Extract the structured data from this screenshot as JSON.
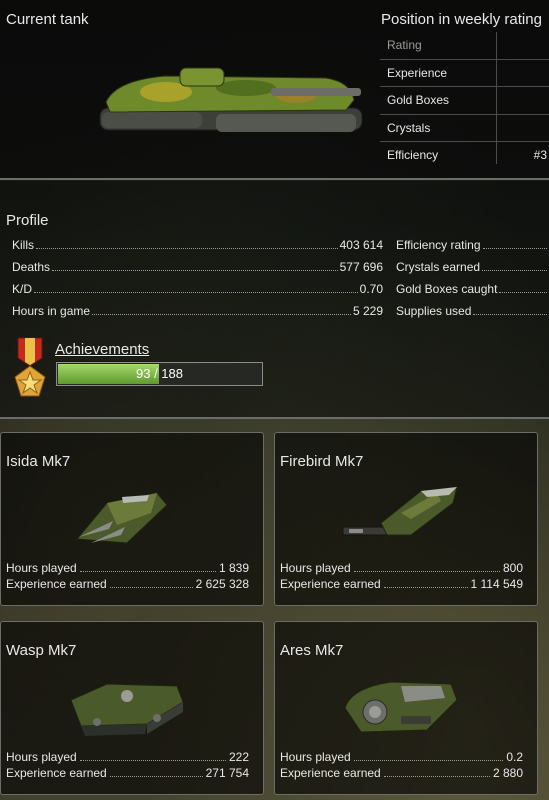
{
  "current_tank": {
    "label": "Current tank"
  },
  "weekly": {
    "title": "Position in weekly rating",
    "rows": [
      {
        "label": "Rating",
        "value": ""
      },
      {
        "label": "Experience",
        "value": ""
      },
      {
        "label": "Gold Boxes",
        "value": ""
      },
      {
        "label": "Crystals",
        "value": ""
      },
      {
        "label": "Efficiency",
        "value": "#3"
      }
    ]
  },
  "profile": {
    "title": "Profile",
    "left_stats": [
      {
        "label": "Kills",
        "value": "403 614"
      },
      {
        "label": "Deaths",
        "value": "577 696"
      },
      {
        "label": "K/D",
        "value": "0.70"
      },
      {
        "label": "Hours in game",
        "value": "5 229"
      }
    ],
    "right_stats": [
      {
        "label": "Efficiency rating",
        "value": ""
      },
      {
        "label": "Crystals earned",
        "value": ""
      },
      {
        "label": "Gold Boxes caught",
        "value": ""
      },
      {
        "label": "Supplies used",
        "value": ""
      }
    ]
  },
  "achievements": {
    "label": "Achievements",
    "progress_text": "93 / 188",
    "progress_fraction": 0.495
  },
  "cards": [
    {
      "name": "Isida Mk7",
      "hours_label": "Hours played",
      "hours": "1 839",
      "exp_label": "Experience earned",
      "exp": "2 625 328"
    },
    {
      "name": "Firebird Mk7",
      "hours_label": "Hours played",
      "hours": "800",
      "exp_label": "Experience earned",
      "exp": "1 114 549"
    },
    {
      "name": "Wasp Mk7",
      "hours_label": "Hours played",
      "hours": "222",
      "exp_label": "Experience earned",
      "exp": "271 754"
    },
    {
      "name": "Ares Mk7",
      "hours_label": "Hours played",
      "hours": "0.2",
      "exp_label": "Experience earned",
      "exp": "2 880"
    }
  ],
  "colors": {
    "progress_fill": "#7fb84a",
    "divider": "#6a6d68",
    "camo_green": "#6f8a2a"
  }
}
